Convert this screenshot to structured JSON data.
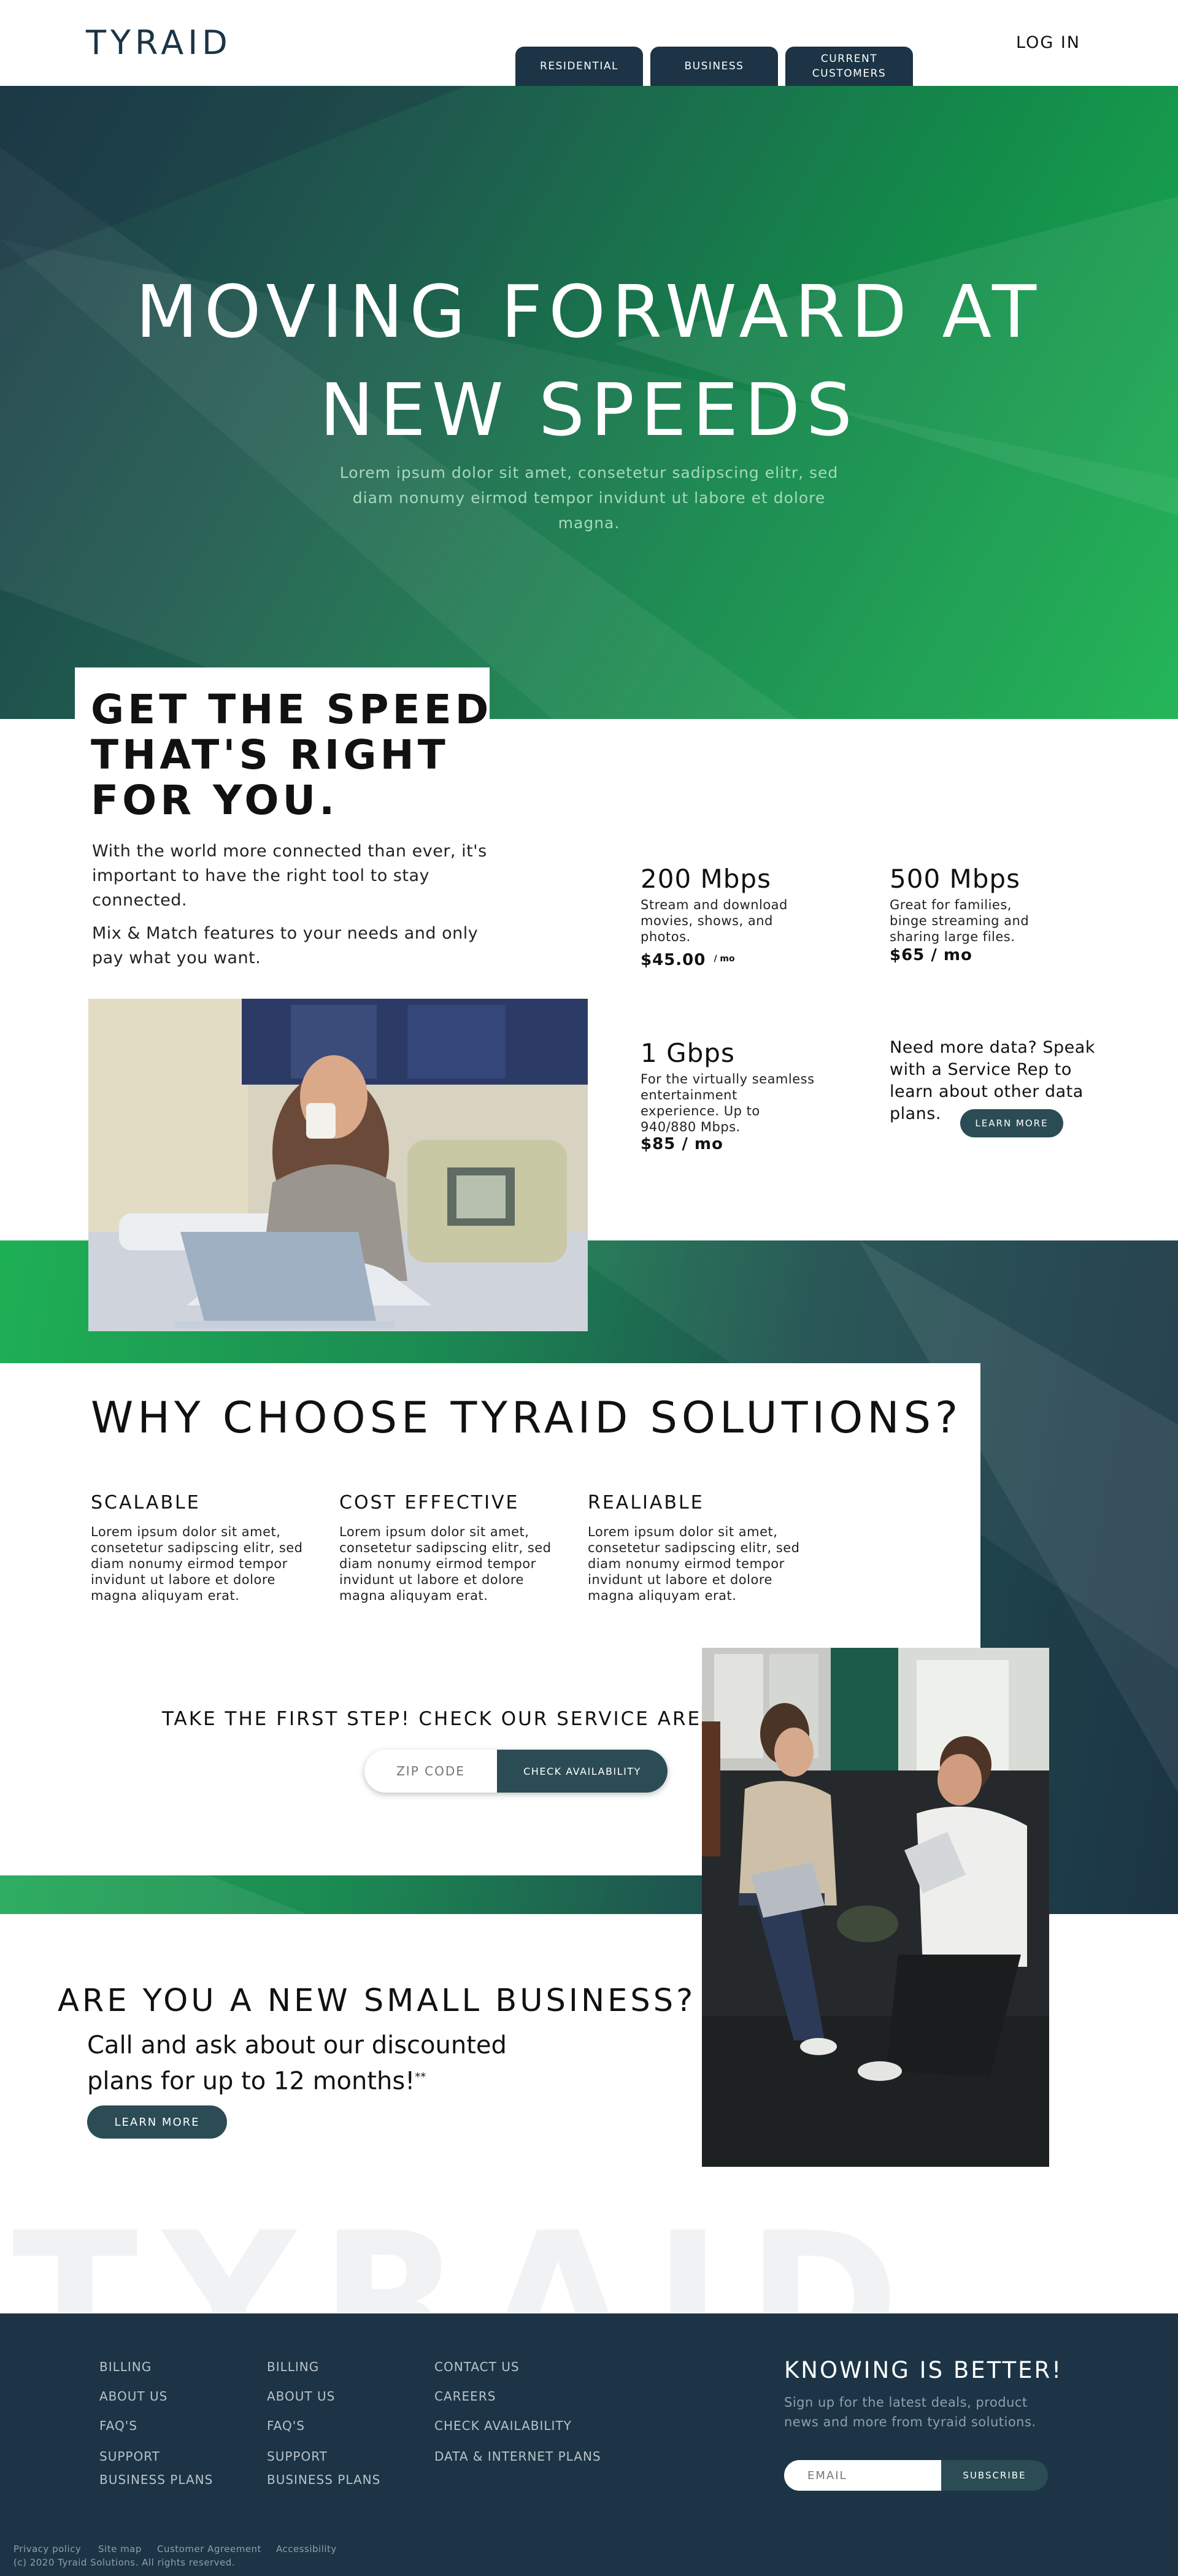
{
  "header": {
    "logo": "TYRAID",
    "tabs": [
      "RESIDENTIAL",
      "BUSINESS",
      "CURRENT CUSTOMERS"
    ],
    "login": "LOG IN"
  },
  "hero": {
    "title_line1": "MOVING FORWARD AT",
    "title_line2": "NEW SPEEDS",
    "subtitle": "Lorem ipsum dolor sit amet, consetetur sadipscing elitr, sed diam nonumy eirmod tempor invidunt ut labore et dolore magna."
  },
  "speed": {
    "title_line1": "GET THE SPEED",
    "title_line2": "THAT'S RIGHT",
    "title_line3": "FOR YOU.",
    "para1": "With the world more connected than ever, it's important to have the right tool to stay connected.",
    "para2": "Mix & Match features to your needs and only pay what you want.",
    "plans": [
      {
        "title": "200 Mbps",
        "desc": "Stream and download movies, shows, and photos.",
        "price": "$45.00",
        "unit": "/ mo"
      },
      {
        "title": "500 Mbps",
        "desc": "Great for families, binge streaming and sharing large files.",
        "price": "$65 / mo"
      },
      {
        "title": "1 Gbps",
        "desc": "For the virtually seamless entertainment experience. Up to 940/880 Mbps.",
        "price": "$85 / mo"
      }
    ],
    "more_data": "Need more data? Speak with a Service Rep to learn about other data plans.",
    "learn_more": "LEARN MORE"
  },
  "why": {
    "title": "WHY CHOOSE TYRAID SOLUTIONS?",
    "items": [
      {
        "heading": "SCALABLE",
        "text": "Lorem ipsum dolor sit amet, consetetur sadipscing elitr, sed diam nonumy eirmod tempor invidunt ut labore et dolore magna aliquyam erat."
      },
      {
        "heading": "COST EFFECTIVE",
        "text": "Lorem ipsum dolor sit amet, consetetur sadipscing elitr, sed diam nonumy eirmod tempor invidunt ut labore et dolore magna aliquyam erat."
      },
      {
        "heading": "REALIABLE",
        "text": "Lorem ipsum dolor sit amet, consetetur sadipscing elitr, sed diam nonumy eirmod tempor invidunt ut labore et dolore magna aliquyam erat."
      }
    ],
    "service_title": "TAKE THE FIRST STEP! CHECK OUR SERVICE AREA",
    "zip_placeholder": "ZIP CODE",
    "check_button": "CHECK AVAILABILITY"
  },
  "business": {
    "title": "ARE YOU A NEW SMALL BUSINESS?",
    "subtitle_line1": "Call and ask about our discounted",
    "subtitle_line2": "plans for up to 12 months!",
    "footnote_mark": "**",
    "learn_more": "LEARN MORE"
  },
  "watermark": "TYRAID",
  "footer": {
    "col1": [
      "BILLING",
      "ABOUT US",
      "FAQ'S",
      "SUPPORT",
      "BUSINESS PLANS"
    ],
    "col2": [
      "BILLING",
      "ABOUT US",
      "FAQ'S",
      "SUPPORT",
      "BUSINESS PLANS"
    ],
    "col3": [
      "CONTACT US",
      "CAREERS",
      "CHECK AVAILABILITY",
      "DATA & INTERNET PLANS"
    ],
    "newsletter_title": "KNOWING IS BETTER!",
    "newsletter_text": "Sign up for the latest deals, product news and more from tyraid solutions.",
    "email_placeholder": "EMAIL",
    "subscribe": "SUBSCRIBE",
    "legal_links": [
      "Privacy policy",
      "Site map",
      "Customer Agreement",
      "Accessibility"
    ],
    "copyright": "(c) 2020 Tyraid Solutions. All rights reserved."
  },
  "colors": {
    "navy": "#1c3445",
    "teal_button": "#2b4c54",
    "green_bright": "#1ab250",
    "green_dark": "#138a4a"
  }
}
